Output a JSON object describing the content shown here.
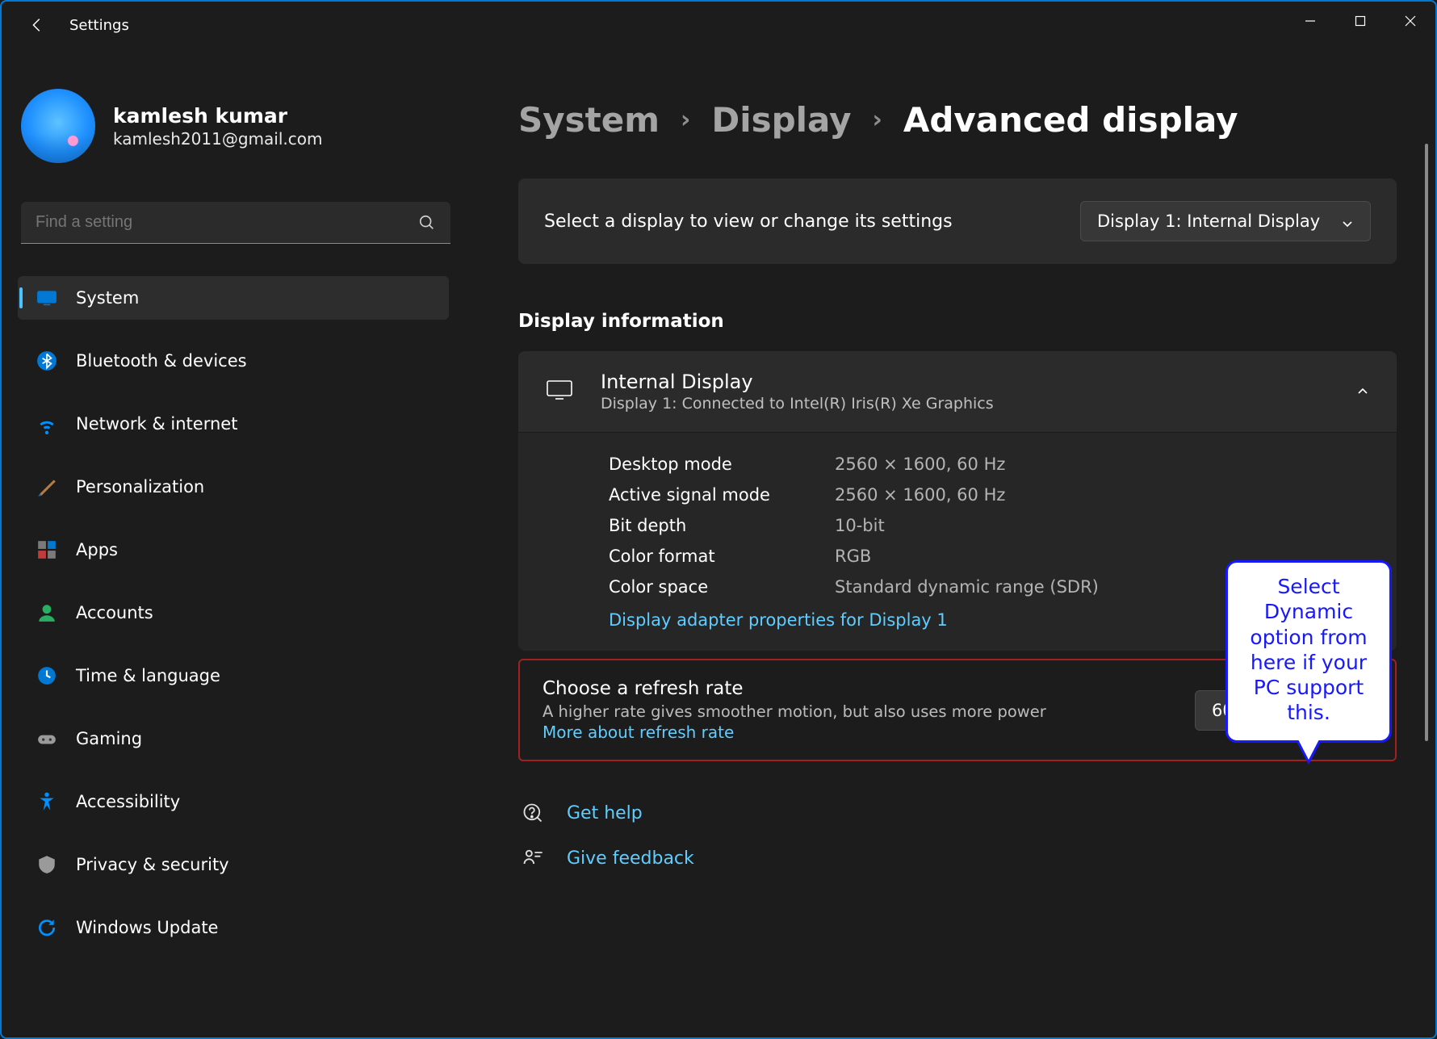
{
  "window": {
    "title": "Settings"
  },
  "profile": {
    "name": "kamlesh kumar",
    "email": "kamlesh2011@gmail.com"
  },
  "search": {
    "placeholder": "Find a setting"
  },
  "sidebar": {
    "items": [
      {
        "label": "System"
      },
      {
        "label": "Bluetooth & devices"
      },
      {
        "label": "Network & internet"
      },
      {
        "label": "Personalization"
      },
      {
        "label": "Apps"
      },
      {
        "label": "Accounts"
      },
      {
        "label": "Time & language"
      },
      {
        "label": "Gaming"
      },
      {
        "label": "Accessibility"
      },
      {
        "label": "Privacy & security"
      },
      {
        "label": "Windows Update"
      }
    ]
  },
  "breadcrumb": {
    "a": "System",
    "b": "Display",
    "c": "Advanced display"
  },
  "selectDisplay": {
    "text": "Select a display to view or change its settings",
    "value": "Display 1: Internal Display"
  },
  "section": {
    "title": "Display information"
  },
  "displayCard": {
    "title": "Internal Display",
    "subtitle": "Display 1: Connected to Intel(R) Iris(R) Xe Graphics",
    "rows": [
      {
        "k": "Desktop mode",
        "v": "2560 × 1600, 60 Hz"
      },
      {
        "k": "Active signal mode",
        "v": "2560 × 1600, 60 Hz"
      },
      {
        "k": "Bit depth",
        "v": "10-bit"
      },
      {
        "k": "Color format",
        "v": "RGB"
      },
      {
        "k": "Color space",
        "v": "Standard dynamic range (SDR)"
      }
    ],
    "adapterLink": "Display adapter properties for Display 1"
  },
  "refresh": {
    "title": "Choose a refresh rate",
    "subtitle": "A higher rate gives smoother motion, but also uses more power",
    "moreLink": "More about refresh rate",
    "value": "60 Hz"
  },
  "help": {
    "getHelp": "Get help",
    "feedback": "Give feedback"
  },
  "callout": {
    "text": "Select Dynamic option from here if your PC support this."
  }
}
